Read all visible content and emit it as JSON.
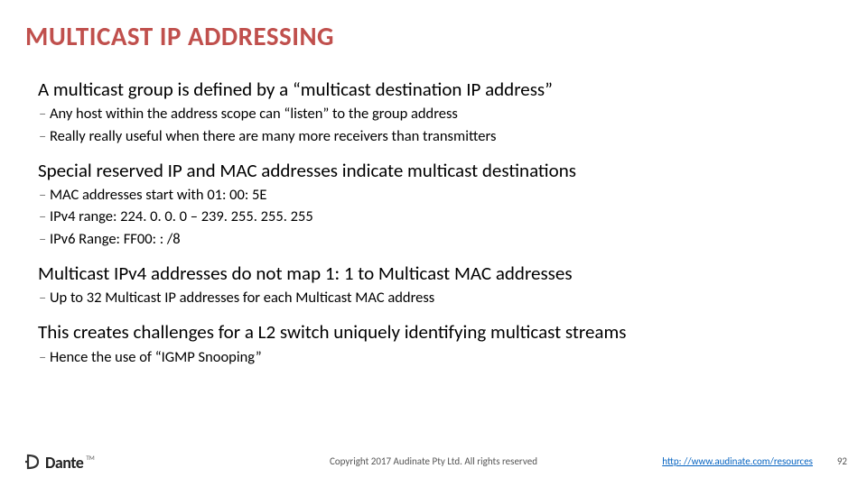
{
  "title": "MULTICAST IP ADDRESSING",
  "blocks": [
    {
      "lead": "A multicast group is defined by a “multicast destination IP address”",
      "subs": [
        "Any host within the address scope can “listen” to the group address",
        "Really really useful when there are many more receivers than transmitters"
      ]
    },
    {
      "lead": "Special reserved IP and MAC addresses indicate multicast destinations",
      "subs": [
        "MAC addresses start with 01: 00: 5E",
        "IPv4 range: 224. 0. 0. 0 – 239. 255. 255. 255",
        "IPv6 Range: FF00: : /8"
      ]
    },
    {
      "lead": "Multicast IPv4 addresses do not map 1: 1 to Multicast MAC addresses",
      "subs": [
        "Up to 32 Multicast IP addresses for each Multicast MAC address"
      ]
    },
    {
      "lead": "This creates challenges for a L2 switch uniquely identifying multicast streams",
      "subs": [
        "Hence the use of “IGMP Snooping”"
      ]
    }
  ],
  "logo": {
    "text": "Dante",
    "tm": "TM",
    "sub": ""
  },
  "copyright": "Copyright 2017 Audinate Pty Ltd. All rights reserved",
  "link": "http: //www.audinate.com/resources",
  "page": "92"
}
